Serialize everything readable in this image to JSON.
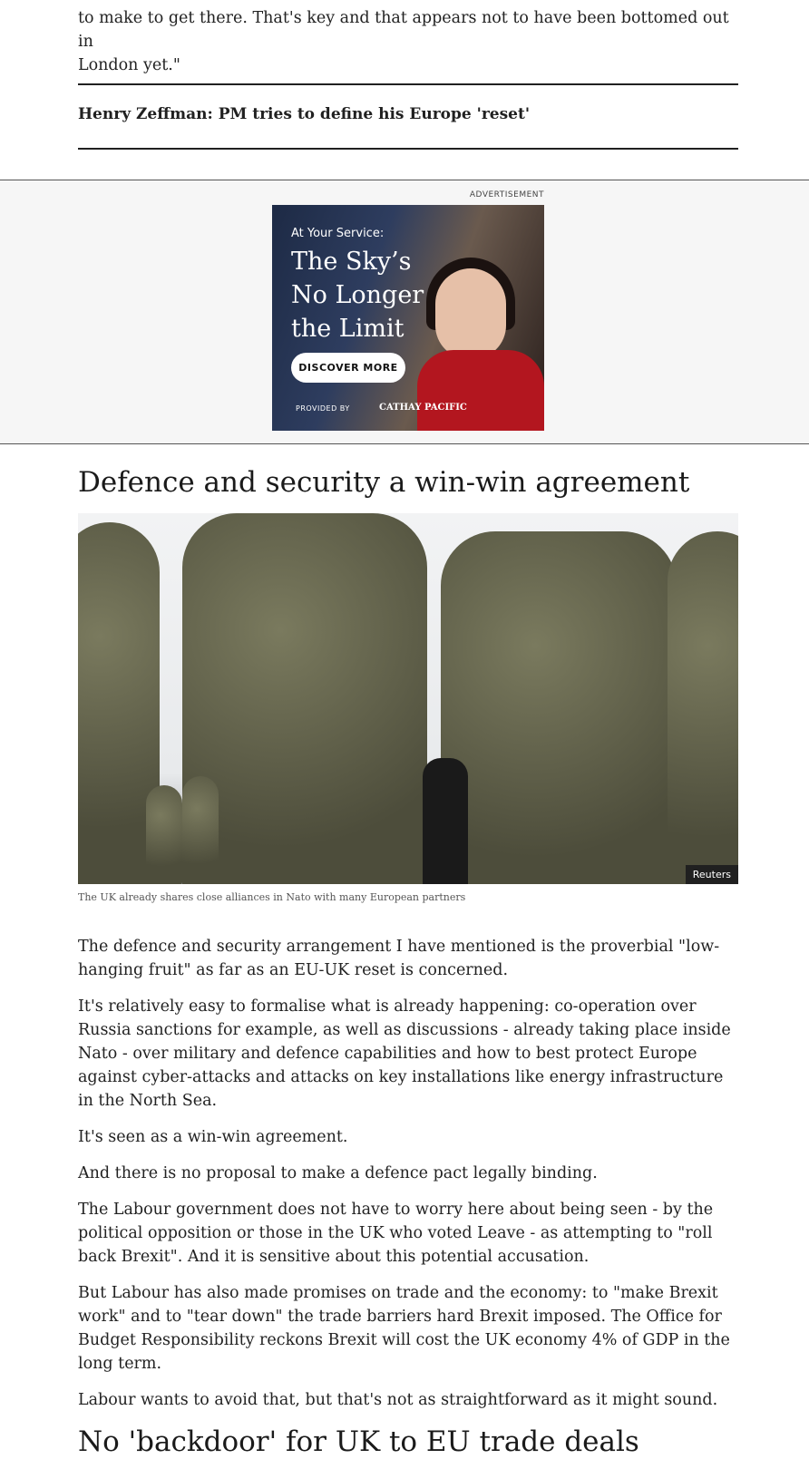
{
  "intro_tail": {
    "lines": [
      "to make to get there. That's key and that appears not to have been bottomed out in",
      "London yet.\""
    ]
  },
  "related_link": "Henry Zeffman: PM tries to define his Europe 'reset'",
  "advert": {
    "label": "ADVERTISEMENT",
    "kicker": "At Your Service:",
    "headline": "The Sky’s No Longer the Limit",
    "cta": "DISCOVER MORE",
    "provided_by": "PROVIDED BY",
    "brand": "CATHAY PACIFIC"
  },
  "section1": {
    "heading": "Defence and security a win-win agreement",
    "image_credit": "Reuters",
    "caption": "The UK already shares close alliances in Nato with many European partners",
    "paragraphs": [
      "The defence and security arrangement I have mentioned is the proverbial \"low-hanging fruit\" as far as an EU-UK reset is concerned.",
      "It's relatively easy to formalise what is already happening: co-operation over Russia sanctions for example, as well as discussions - already taking place inside Nato - over military and defence capabilities and how to best protect Europe against cyber-attacks and attacks on key installations like energy infrastructure in the North Sea.",
      "It's seen as a win-win agreement.",
      "And there is no proposal to make a defence pact legally binding.",
      "The Labour government does not have to worry here about being seen - by the political opposition or those in the UK who voted Leave - as attempting to \"roll back Brexit\". And it is sensitive about this potential accusation.",
      "But Labour has also made promises on trade and the economy: to \"make Brexit work\" and to \"tear down\" the trade barriers hard Brexit imposed. The Office for Budget Responsibility reckons Brexit will cost the UK economy 4% of GDP in the long term.",
      "Labour wants to avoid that, but that's not as straightforward as it might sound."
    ]
  },
  "section2": {
    "heading": "No 'backdoor' for UK to EU trade deals"
  }
}
